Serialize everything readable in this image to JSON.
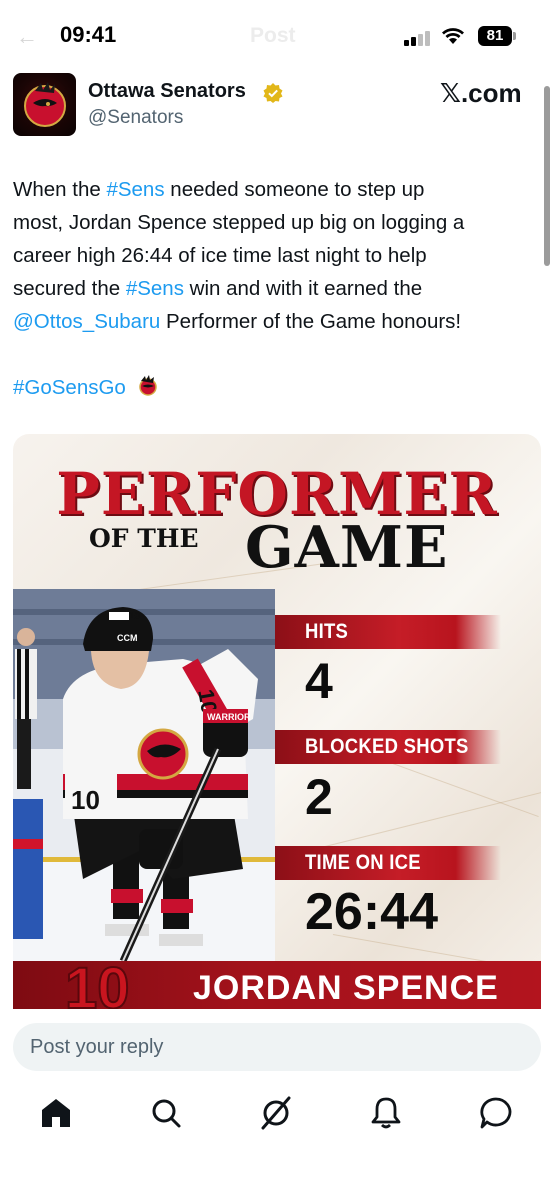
{
  "status_bar": {
    "time": "09:41",
    "header_title": "Post",
    "battery": "81"
  },
  "tweet": {
    "display_name": "Ottawa Senators",
    "handle": "@Senators",
    "source": "𝕏.com",
    "text": {
      "line1_a": "When the ",
      "tag_sens_1": "#Sens",
      "line1_b": " needed someone to step up",
      "line2": "most, Jordan Spence stepped up big on logging a",
      "line3": "career high 26:44 of ice time last night to help",
      "line4_a": "secured the ",
      "tag_sens_2": "#Sens",
      "line4_b": " win and with it earned the",
      "mention": "@Ottos_Subaru",
      "line5_b": " Performer of the Game honours!",
      "hashtag_go": "#GoSensGo"
    }
  },
  "graphic": {
    "title": "PERFORMER",
    "subtitle_small": "OF THE",
    "subtitle_big": "GAME",
    "jersey_number": "10",
    "stats": [
      {
        "label": "HITS",
        "value": "4"
      },
      {
        "label": "BLOCKED SHOTS",
        "value": "2"
      },
      {
        "label": "TIME ON ICE",
        "value": "26:44"
      }
    ],
    "banner_number": "10",
    "player_name": "JORDAN SPENCE",
    "photo_jersey_text": "10",
    "glove_brand": "WARRIOR",
    "helmet_brand": "CCM"
  },
  "reply": {
    "placeholder": "Post your reply"
  },
  "nav": [
    "home-icon",
    "search-icon",
    "grok-icon",
    "notifications-icon",
    "messages-icon"
  ],
  "colors": {
    "accent": "#1d9bf0",
    "sens_red": "#c41624",
    "verified_gold": "#e2b719"
  }
}
